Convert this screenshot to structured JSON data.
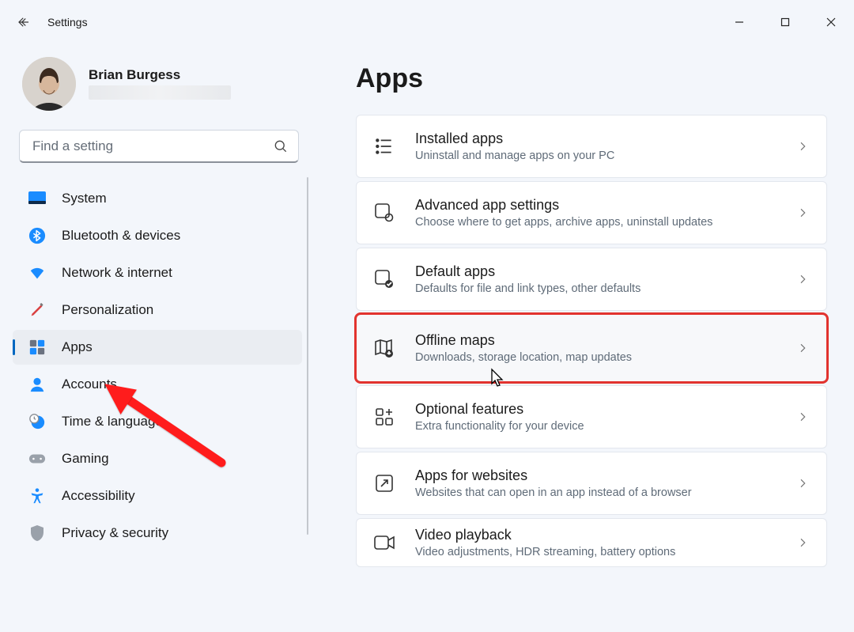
{
  "window": {
    "app_title": "Settings"
  },
  "profile": {
    "name": "Brian Burgess"
  },
  "search": {
    "placeholder": "Find a setting"
  },
  "sidebar": {
    "items": [
      {
        "icon": "system",
        "label": "System"
      },
      {
        "icon": "bluetooth",
        "label": "Bluetooth & devices"
      },
      {
        "icon": "wifi",
        "label": "Network & internet"
      },
      {
        "icon": "personalization",
        "label": "Personalization"
      },
      {
        "icon": "apps",
        "label": "Apps"
      },
      {
        "icon": "accounts",
        "label": "Accounts"
      },
      {
        "icon": "time",
        "label": "Time & language"
      },
      {
        "icon": "gaming",
        "label": "Gaming"
      },
      {
        "icon": "accessibility",
        "label": "Accessibility"
      },
      {
        "icon": "privacy",
        "label": "Privacy & security"
      }
    ],
    "selected_index": 4
  },
  "page": {
    "title": "Apps",
    "cards": [
      {
        "icon": "installed",
        "title": "Installed apps",
        "sub": "Uninstall and manage apps on your PC"
      },
      {
        "icon": "advanced",
        "title": "Advanced app settings",
        "sub": "Choose where to get apps, archive apps, uninstall updates"
      },
      {
        "icon": "default",
        "title": "Default apps",
        "sub": "Defaults for file and link types, other defaults"
      },
      {
        "icon": "maps",
        "title": "Offline maps",
        "sub": "Downloads, storage location, map updates"
      },
      {
        "icon": "optional",
        "title": "Optional features",
        "sub": "Extra functionality for your device"
      },
      {
        "icon": "websites",
        "title": "Apps for websites",
        "sub": "Websites that can open in an app instead of a browser"
      },
      {
        "icon": "video",
        "title": "Video playback",
        "sub": "Video adjustments, HDR streaming, battery options"
      }
    ],
    "highlight_index": 3
  }
}
